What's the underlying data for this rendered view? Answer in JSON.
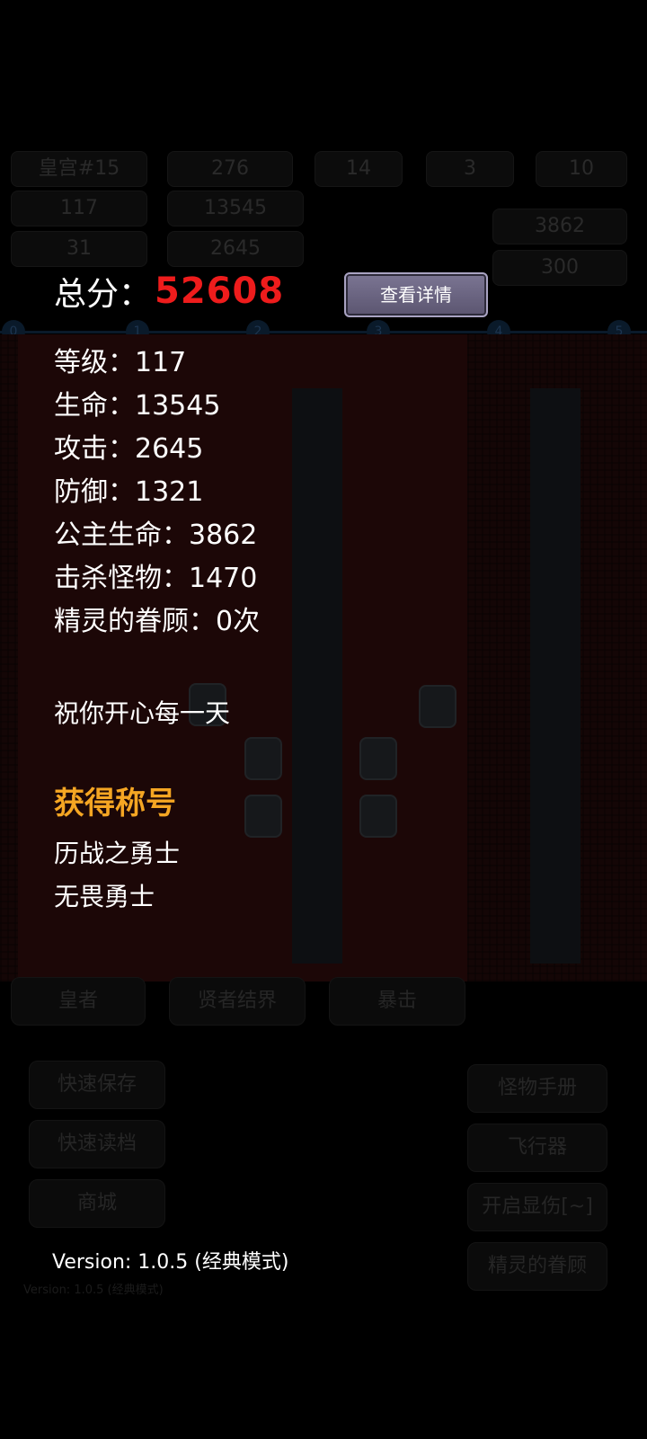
{
  "background": {
    "top_stats": [
      "皇宫#15",
      "276",
      "14",
      "3",
      "10",
      "117",
      "13545",
      "3862",
      "31",
      "2645",
      "300"
    ],
    "floor_markers": [
      "0",
      "1",
      "2",
      "3",
      "4",
      "5"
    ],
    "bottom_buttons": [
      "皇者",
      "贤者结界",
      "暴击",
      "快速保存",
      "怪物手册",
      "快速读档",
      "飞行器",
      "商城",
      "开启显伤[~]",
      "精灵的眷顾"
    ],
    "version_small": "Version: 1.0.5 (经典模式)"
  },
  "result": {
    "score_label": "总分：",
    "score_value": "52608",
    "detail_button": "查看详情",
    "stats": [
      "等级：117",
      "生命：13545",
      "攻击：2645",
      "防御：1321",
      "公主生命：3862",
      "击杀怪物：1470",
      "精灵的眷顾：0次"
    ],
    "wish": "祝你开心每一天",
    "titles_header": "获得称号",
    "titles": [
      "历战之勇士",
      "无畏勇士"
    ],
    "version": "Version: 1.0.5 (经典模式)"
  },
  "colors": {
    "score": "#ee1c1c",
    "titles_header": "#f5a623",
    "button": "#6b6582"
  }
}
